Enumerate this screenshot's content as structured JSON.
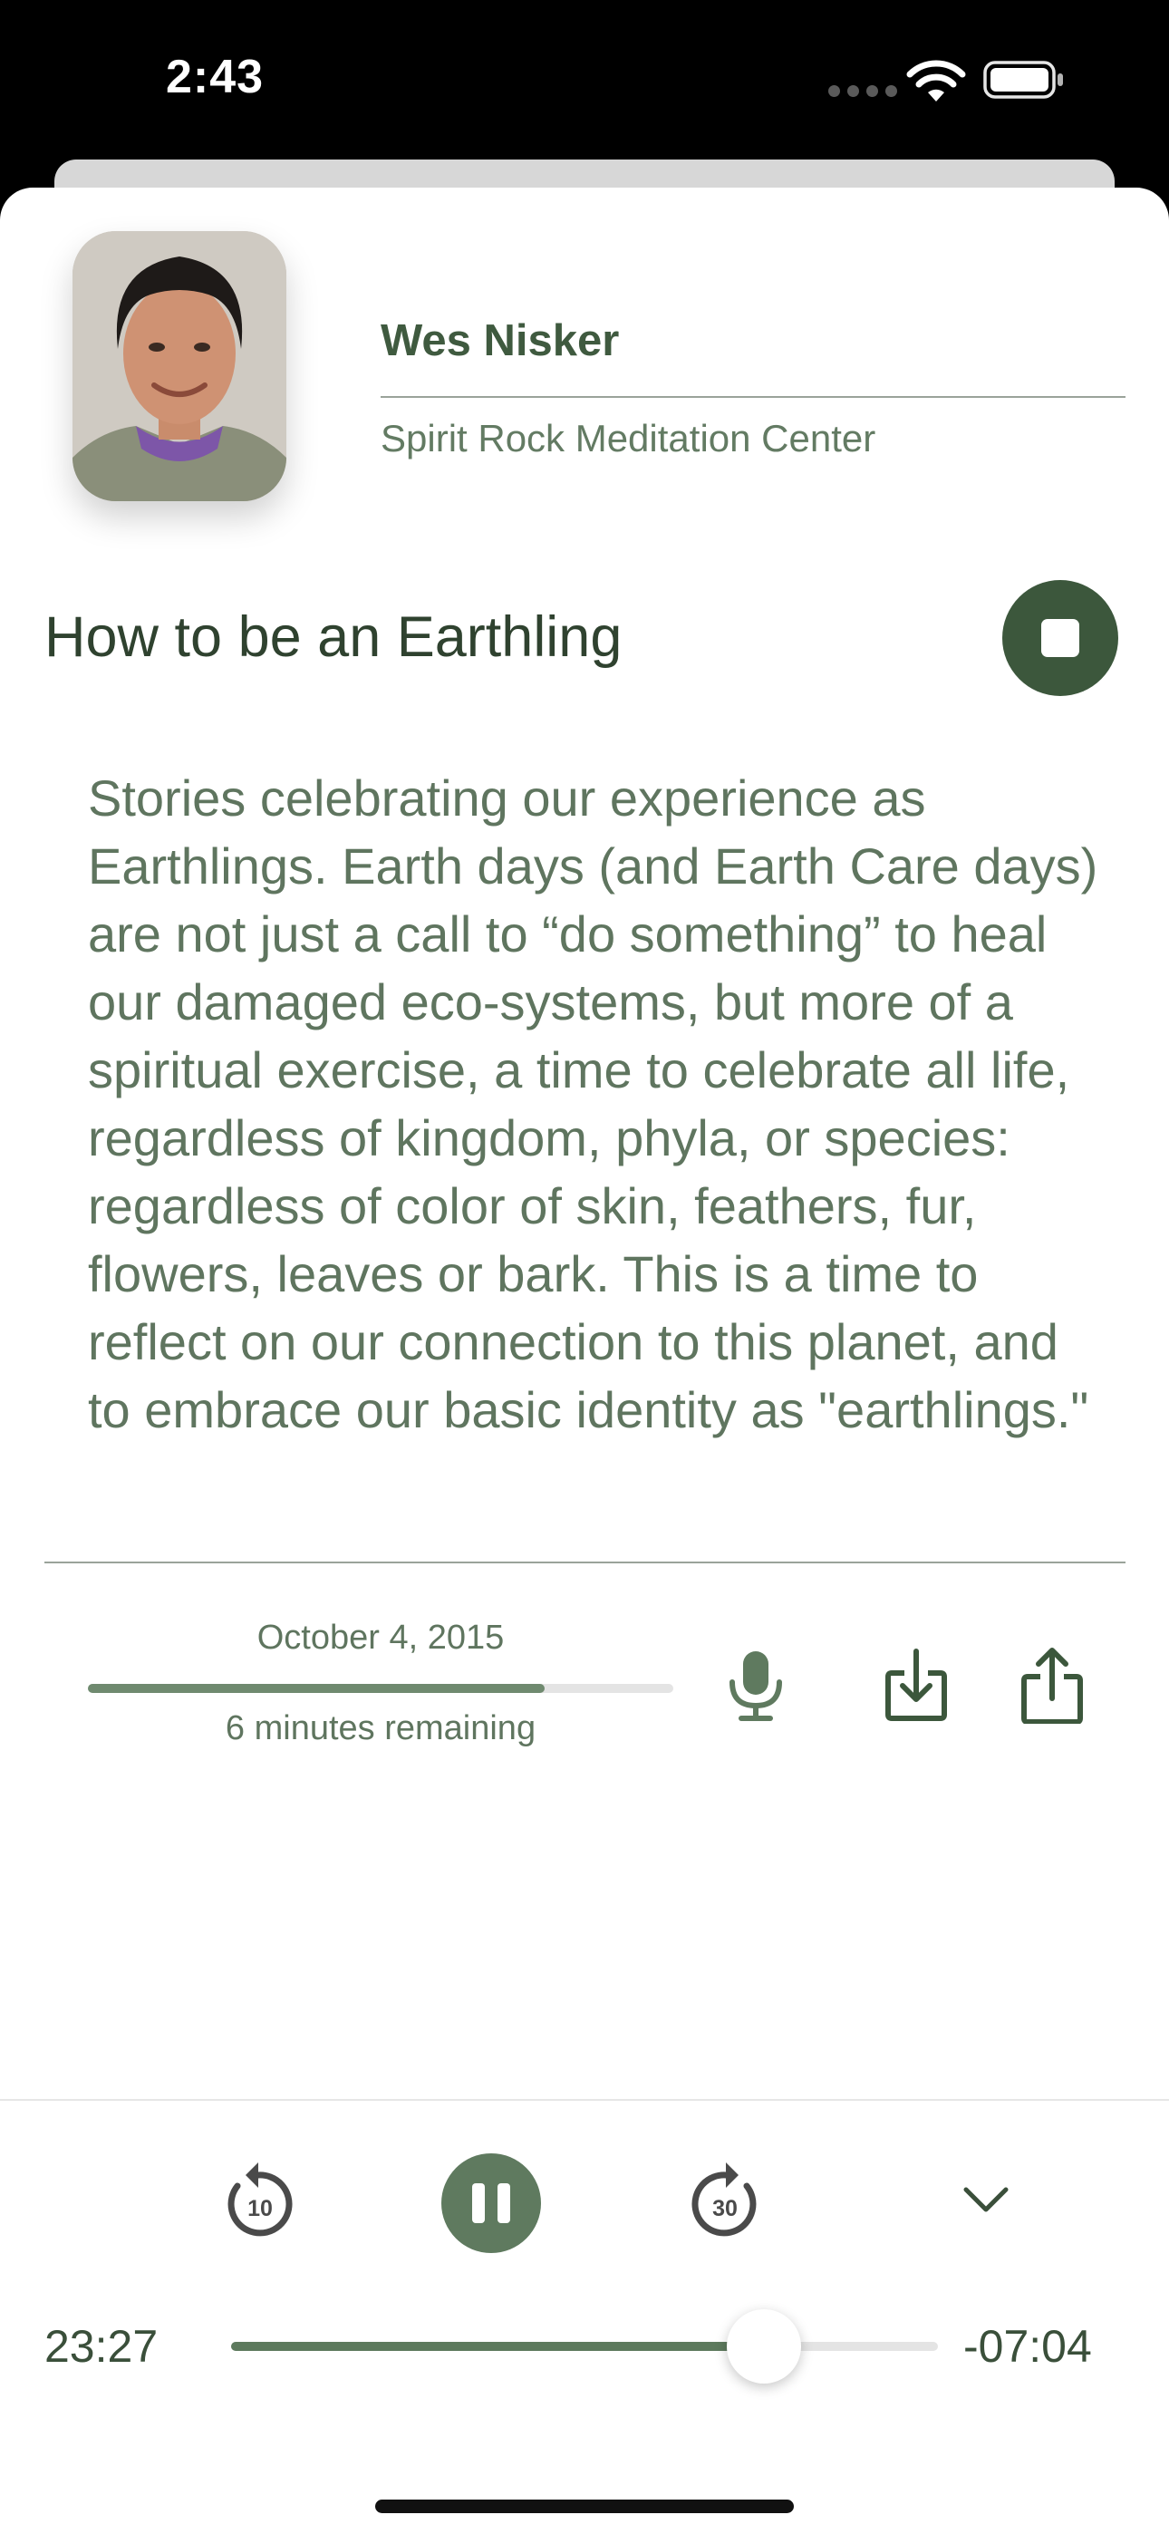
{
  "status_bar": {
    "time": "2:43"
  },
  "teacher": {
    "name": "Wes Nisker",
    "center": "Spirit Rock Meditation Center"
  },
  "talk": {
    "title": "How to be an Earthling",
    "description": "Stories celebrating our experience as Earthlings. Earth days (and Earth Care days) are not just a call to “do something” to heal our damaged eco-systems, but more of a spiritual exercise, a time to celebrate all life, regardless of kingdom, phyla, or species: regardless of color of skin, feathers, fur, flowers, leaves or bark. This is a time to reflect on our connection to this planet, and to embrace our basic identity as \"earthlings.\"",
    "date": "October 4, 2015",
    "remaining": "6 minutes remaining",
    "listened_fraction": 0.78
  },
  "player": {
    "elapsed": "23:27",
    "remaining": "-07:04",
    "position_fraction": 0.754,
    "rewind_seconds": "10",
    "forward_seconds": "30"
  },
  "icons": {
    "stop": "stop-icon",
    "mic": "microphone-icon",
    "download": "download-icon",
    "share": "share-icon",
    "rewind": "rewind-10-icon",
    "pause": "pause-icon",
    "forward": "forward-30-icon",
    "collapse": "chevron-down-icon"
  },
  "colors": {
    "accent": "#3c573c",
    "text": "#3a4f3a",
    "muted": "#5f755f"
  }
}
